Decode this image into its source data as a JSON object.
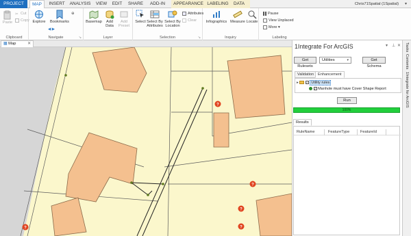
{
  "tabs": [
    {
      "label": "PROJECT"
    },
    {
      "label": "MAP"
    },
    {
      "label": "INSERT"
    },
    {
      "label": "ANALYSIS"
    },
    {
      "label": "VIEW"
    },
    {
      "label": "EDIT"
    },
    {
      "label": "SHARE"
    },
    {
      "label": "ADD-IN"
    },
    {
      "label": "APPEARANCE"
    },
    {
      "label": "LABELING"
    },
    {
      "label": "DATA"
    }
  ],
  "user": "Chris71Spatial (1Spatial)",
  "ribbon": {
    "clipboard": {
      "label": "Clipboard",
      "paste": "Paste",
      "cut": "Cut",
      "copy": "Copy"
    },
    "navigate": {
      "label": "Navigate",
      "explore": "Explore",
      "bookmarks": "Bookmarks"
    },
    "layer": {
      "label": "Layer",
      "basemap": "Basemap",
      "add_data": "Add Data",
      "add_preset": "Add Preset"
    },
    "selection": {
      "label": "Selection",
      "select": "Select",
      "select_by_attributes": "Select By Attributes",
      "select_by_location": "Select By Location",
      "attributes": "Attributes",
      "clear": "Clear"
    },
    "inquiry": {
      "label": "Inquiry",
      "infographics": "Infographics",
      "measure": "Measure",
      "locate": "Locate"
    },
    "labeling": {
      "label": "Labeling",
      "pause": "Pause",
      "view_unplaced": "View Unplaced",
      "more": "More"
    }
  },
  "map_tab": "Map",
  "pane": {
    "title": "1Integrate For ArcGIS",
    "get_rulesets": "Get Rulesets",
    "ruleset_value": "Utilities",
    "get_schema": "Get Schema",
    "tabs": [
      "Validation",
      "Enhancement"
    ],
    "tree_root": "Utility rules",
    "tree_child": "Manhole must have Cover Shape Report",
    "run": "Run",
    "progress_text": "100%",
    "progress_value": 100,
    "results_tab": "Results",
    "columns": [
      "RuleName",
      "FeatureType",
      "FeatureId"
    ]
  },
  "side_tabs": [
    "Tasks",
    "Contents",
    "1Integrate for ArcGIS"
  ],
  "colors": {
    "accent": "#1e6fc0",
    "map_background": "#fbf7cc",
    "building": "#f4c08f",
    "progress": "#22cf3c",
    "error_marker": "#e0431f"
  }
}
